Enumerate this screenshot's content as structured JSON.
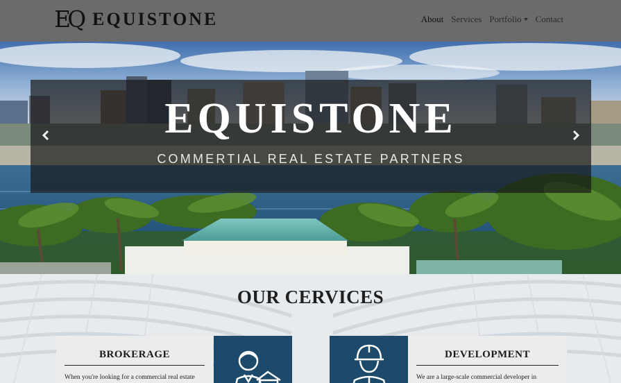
{
  "brand": {
    "logo_mark": "EQ",
    "logo_text": "EQUISTONE"
  },
  "nav": {
    "items": [
      {
        "label": "About"
      },
      {
        "label": "Services"
      },
      {
        "label": "Portfolio"
      },
      {
        "label": "Contact"
      }
    ]
  },
  "hero": {
    "title": "EQUISTONE",
    "subtitle": "COMMERTIAL REAL ESTATE PARTNERS",
    "prev_icon": "chevron-left-icon",
    "next_icon": "chevron-right-icon"
  },
  "services": {
    "title": "OUR CERVICES",
    "cards": [
      {
        "heading": "BROKERAGE",
        "text": "When you're looking for a commercial real estate",
        "icon": "agent-icon"
      },
      {
        "heading": "DEVELOPMENT",
        "text": "We are a large-scale commercial developer in",
        "icon": "builder-helmet-icon"
      }
    ]
  },
  "colors": {
    "navbar": "#6b6b6b",
    "caption_overlay": "rgba(20,20,20,0.68)",
    "icon_box": "#1d4a6b",
    "card": "#ececec"
  }
}
